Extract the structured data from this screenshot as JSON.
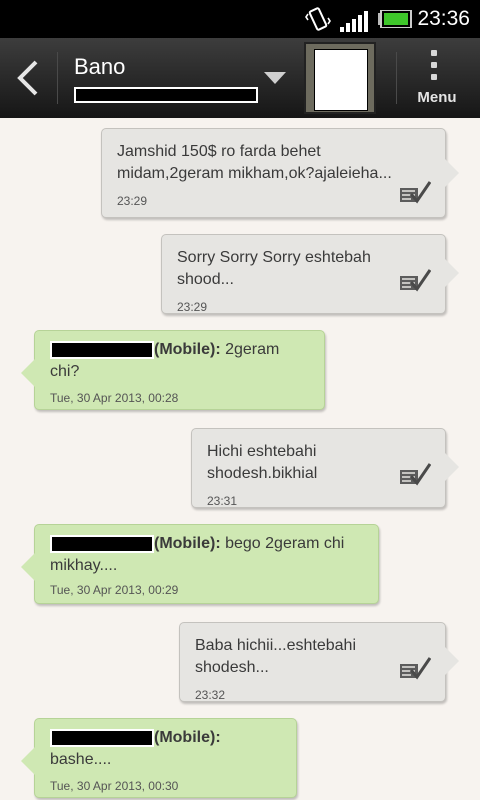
{
  "status": {
    "time": "23:36"
  },
  "header": {
    "contact_name": "Bano",
    "menu_label": "Menu"
  },
  "messages": [
    {
      "type": "sent",
      "text": "Jamshid 150$ ro farda behet midam,2geram mikham,ok?ajaleieha...",
      "time": "23:29"
    },
    {
      "type": "sent",
      "text": "Sorry Sorry Sorry eshtebah shood...",
      "time": "23:29"
    },
    {
      "type": "received",
      "sender_suffix": "(Mobile):",
      "text": "2geram chi?",
      "time": "Tue, 30 Apr 2013, 00:28"
    },
    {
      "type": "sent",
      "text": "Hichi eshtebahi shodesh.bikhial",
      "time": "23:31"
    },
    {
      "type": "received",
      "sender_suffix": "(Mobile):",
      "text": "bego 2geram chi mikhay....",
      "time": "Tue, 30 Apr 2013, 00:29"
    },
    {
      "type": "sent",
      "text": "Baba hichii...eshtebahi shodesh...",
      "time": "23:32"
    },
    {
      "type": "received",
      "sender_suffix": "(Mobile):",
      "text": "bashe....",
      "time": "Tue, 30 Apr 2013, 00:30"
    }
  ],
  "icons": {
    "back": "chevron-left-icon",
    "dropdown": "triangle-down-icon",
    "menu": "overflow-dots-icon",
    "delivered": "delivered-check-icon",
    "vibrate": "vibrate-icon",
    "signal": "signal-icon",
    "battery": "battery-icon"
  },
  "colors": {
    "sent_bubble": "#e6e5e2",
    "received_bubble": "#cfe8b3",
    "background": "#f7f3ef",
    "battery_fill": "#3ec62a"
  }
}
